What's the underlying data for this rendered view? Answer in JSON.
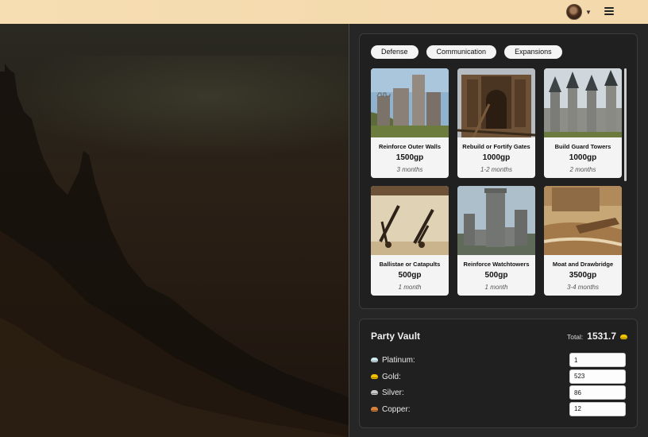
{
  "colors": {
    "header_bg": "#f4dbaf",
    "panel_bg": "#202020",
    "card_bg": "#f4f4f4",
    "platinum": "#cfe9ee",
    "gold": "#f2c200",
    "silver": "#c8c8c8",
    "copper": "#d6823a"
  },
  "header": {
    "avatar_icon": "user-avatar",
    "chevron_icon": "chevron-down-icon",
    "menu_icon": "hamburger-menu-icon"
  },
  "tabs": [
    {
      "label": "Defense"
    },
    {
      "label": "Communication"
    },
    {
      "label": "Expansions"
    }
  ],
  "upgrades": [
    {
      "name": "Reinforce Outer Walls",
      "price": "1500gp",
      "duration": "3 months"
    },
    {
      "name": "Rebuild or Fortify Gates",
      "price": "1000gp",
      "duration": "1-2 months"
    },
    {
      "name": "Build Guard Towers",
      "price": "1000gp",
      "duration": "2 months"
    },
    {
      "name": "Ballistae or Catapults",
      "price": "500gp",
      "duration": "1 month"
    },
    {
      "name": "Reinforce Watchtowers",
      "price": "500gp",
      "duration": "1 month"
    },
    {
      "name": "Moat and Drawbridge",
      "price": "3500gp",
      "duration": "3-4 months"
    }
  ],
  "vault": {
    "title": "Party Vault",
    "total_label": "Total:",
    "total_value": "1531.7",
    "coins": [
      {
        "name": "Platinum:",
        "value": "1"
      },
      {
        "name": "Gold:",
        "value": "523"
      },
      {
        "name": "Silver:",
        "value": "86"
      },
      {
        "name": "Copper:",
        "value": "12"
      }
    ]
  }
}
